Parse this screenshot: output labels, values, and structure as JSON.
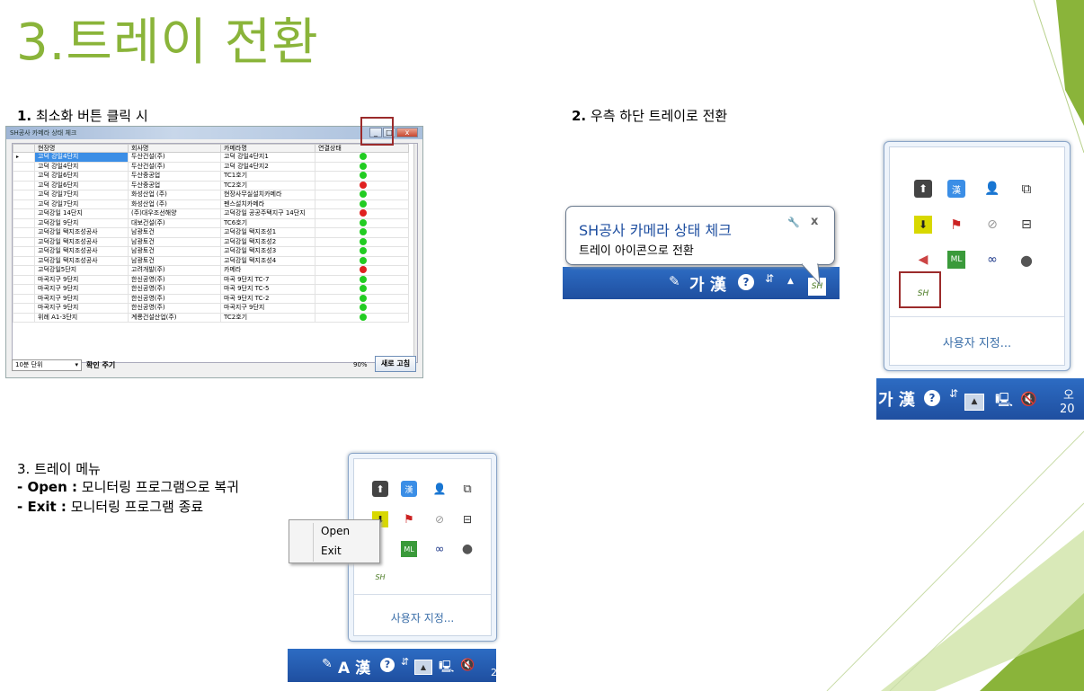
{
  "title": "3.트레이 전환",
  "step1": {
    "num": "1.",
    "text": "최소화 버튼 클릭 시"
  },
  "step2": {
    "num": "2.",
    "text": "우측 하단 트레이로 전환"
  },
  "step3": {
    "heading": "3. 트레이 메뉴",
    "line1_key": "- Open :",
    "line1_text": "모니터링 프로그램으로 복귀",
    "line2_key": "- Exit :",
    "line2_text": "모니터링 프로그램 종료"
  },
  "window": {
    "title": "SH공사 카메라 상태 체크",
    "min": "_",
    "max": "□",
    "close": "x",
    "columns": [
      "현장명",
      "회사명",
      "카메라명",
      "연결상태"
    ],
    "rows": [
      {
        "site": "고덕 강일4단지",
        "company": "두산건설(주)",
        "camera": "고덕 강일4단지1",
        "status": "green",
        "selected": true
      },
      {
        "site": "고덕 강일4단지",
        "company": "두산건설(주)",
        "camera": "고덕 강일4단지2",
        "status": "green"
      },
      {
        "site": "고덕 강일6단지",
        "company": "두산중공업",
        "camera": "TC1호기",
        "status": "green"
      },
      {
        "site": "고덕 강일6단지",
        "company": "두산중공업",
        "camera": "TC2호기",
        "status": "red"
      },
      {
        "site": "고덕 강일7단지",
        "company": "화성산업 (주)",
        "camera": "현장사무실설치카메라",
        "status": "green"
      },
      {
        "site": "고덕 강일7단지",
        "company": "화성산업 (주)",
        "camera": "펜스설치카메라",
        "status": "green"
      },
      {
        "site": "고덕강일 14단지",
        "company": "(주)대우조선해양",
        "camera": "고덕강일 공공주택지구 14단지",
        "status": "red"
      },
      {
        "site": "고덕강일 9단지",
        "company": "대보건설(주)",
        "camera": "TC6호기",
        "status": "green"
      },
      {
        "site": "고덕강일 택지조성공사",
        "company": "남광토건",
        "camera": "고덕강일 택지조성1",
        "status": "green"
      },
      {
        "site": "고덕강일 택지조성공사",
        "company": "남광토건",
        "camera": "고덕강일 택지조성2",
        "status": "green"
      },
      {
        "site": "고덕강일 택지조성공사",
        "company": "남광토건",
        "camera": "고덕강일 택지조성3",
        "status": "green"
      },
      {
        "site": "고덕강일 택지조성공사",
        "company": "남광토건",
        "camera": "고덕강일 택지조성4",
        "status": "green"
      },
      {
        "site": "고덕강일5단지",
        "company": "고려개발(주)",
        "camera": "카메라",
        "status": "red"
      },
      {
        "site": "마곡지구 9단지",
        "company": "한신공영(주)",
        "camera": "마곡 9단지 TC-7",
        "status": "green"
      },
      {
        "site": "마곡지구 9단지",
        "company": "한신공영(주)",
        "camera": "마곡 9단지 TC-5",
        "status": "green"
      },
      {
        "site": "마곡지구 9단지",
        "company": "한신공영(주)",
        "camera": "마곡 9단지 TC-2",
        "status": "green"
      },
      {
        "site": "마곡지구 9단지",
        "company": "한신공영(주)",
        "camera": "마곡지구 9단지",
        "status": "green"
      },
      {
        "site": "위례 A1-3단지",
        "company": "계룡건설산업(주)",
        "camera": "TC2호기",
        "status": "green"
      }
    ],
    "interval": "10분 단위",
    "confirm_label": "확인 주기",
    "percent": "90%",
    "refresh": "새로 고침",
    "colors": {
      "green": "#22cc22",
      "red": "#e02020",
      "selected": "#3b8ee6"
    }
  },
  "balloon": {
    "title": "SH공사 카메라 상태 체크",
    "text": "트레이 아이콘으로 전환",
    "close": "x",
    "pin": "🔧"
  },
  "taskbar": {
    "ime": "가 漢",
    "ime2": "A 漢",
    "help": "?",
    "arrow": "▲",
    "sh": "SH",
    "partial1": "오",
    "partial2": "20",
    "partial3": "2"
  },
  "tray": {
    "customize": "사용자 지정..."
  },
  "context_menu": {
    "open": "Open",
    "exit": "Exit"
  },
  "accent": "#8ab43a"
}
